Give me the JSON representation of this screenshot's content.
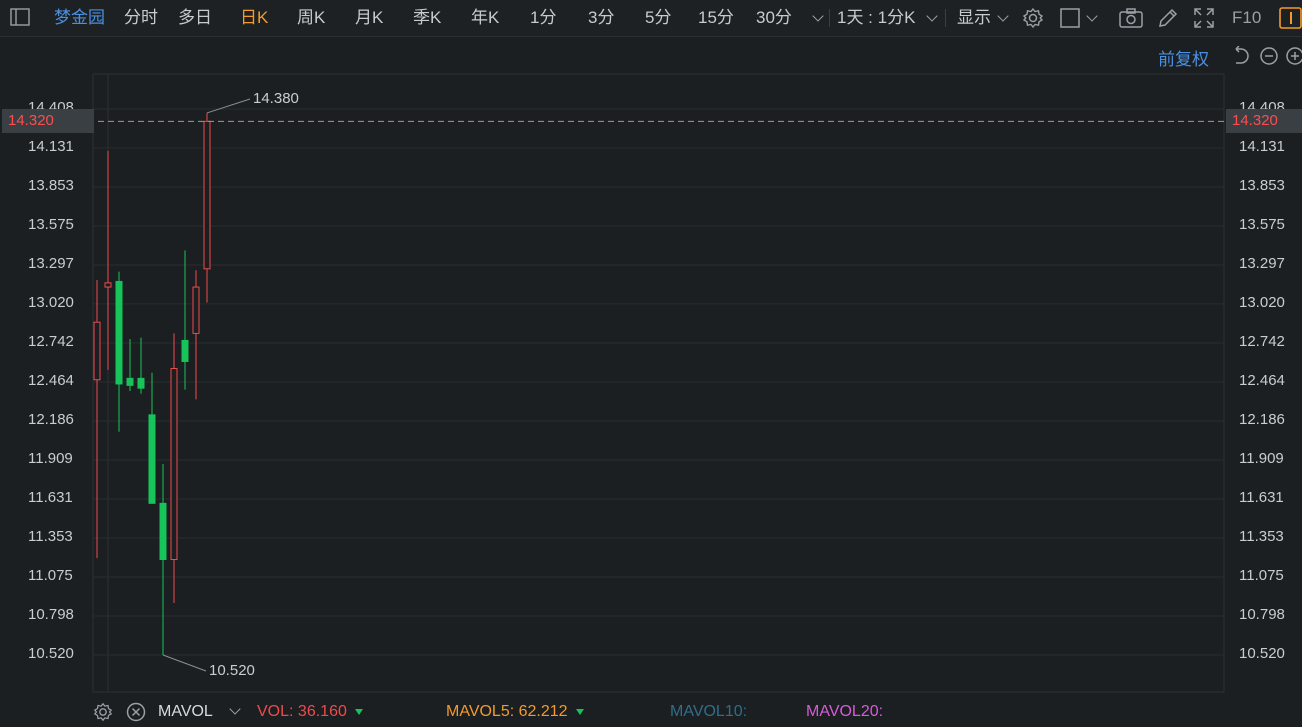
{
  "toolbar": {
    "stock_name": "梦金园",
    "tabs": [
      {
        "label": "分时",
        "x": 124
      },
      {
        "label": "多日",
        "x": 178
      },
      {
        "label": "日K",
        "x": 240,
        "active": true
      },
      {
        "label": "周K",
        "x": 297
      },
      {
        "label": "月K",
        "x": 355
      },
      {
        "label": "季K",
        "x": 413
      },
      {
        "label": "年K",
        "x": 471
      },
      {
        "label": "1分",
        "x": 530
      },
      {
        "label": "3分",
        "x": 588
      },
      {
        "label": "5分",
        "x": 645
      },
      {
        "label": "15分",
        "x": 698
      },
      {
        "label": "30分",
        "x": 756
      }
    ],
    "period_select": "1天 : 1分K",
    "display_label": "显示",
    "f10_label": "F10"
  },
  "chart_header": {
    "adjust_label": "前复权"
  },
  "current_price": "14.320",
  "annotations": {
    "high": "14.380",
    "low": "10.520"
  },
  "chart_data": {
    "type": "candlestick",
    "y_ticks": [
      "14.408",
      "14.131",
      "13.853",
      "13.575",
      "13.297",
      "13.020",
      "12.742",
      "12.464",
      "12.186",
      "11.909",
      "11.631",
      "11.353",
      "11.075",
      "10.798",
      "10.520"
    ],
    "ylim": [
      10.52,
      14.408
    ],
    "candles": [
      {
        "open": 12.48,
        "close": 12.89,
        "high": 13.19,
        "low": 11.21,
        "up": true
      },
      {
        "open": 13.14,
        "close": 13.17,
        "high": 14.11,
        "low": 12.55,
        "up": true
      },
      {
        "open": 13.18,
        "close": 12.45,
        "high": 13.25,
        "low": 12.11,
        "up": false
      },
      {
        "open": 12.49,
        "close": 12.44,
        "high": 12.77,
        "low": 12.4,
        "up": false
      },
      {
        "open": 12.49,
        "close": 12.42,
        "high": 12.78,
        "low": 12.38,
        "up": false
      },
      {
        "open": 12.23,
        "close": 11.6,
        "high": 12.53,
        "low": 11.6,
        "up": false
      },
      {
        "open": 11.6,
        "close": 11.2,
        "high": 11.88,
        "low": 10.52,
        "up": false
      },
      {
        "open": 11.2,
        "close": 12.56,
        "high": 12.81,
        "low": 10.89,
        "up": true
      },
      {
        "open": 12.76,
        "close": 12.61,
        "high": 13.4,
        "low": 12.41,
        "up": false
      },
      {
        "open": 12.81,
        "close": 13.14,
        "high": 13.26,
        "low": 12.34,
        "up": true
      },
      {
        "open": 13.27,
        "close": 14.32,
        "high": 14.38,
        "low": 13.03,
        "up": true
      }
    ]
  },
  "indicators": {
    "name": "MAVOL",
    "vol_label": "VOL:",
    "vol_value": "36.160",
    "mavol5_label": "MAVOL5:",
    "mavol5_value": "62.212",
    "mavol10_label": "MAVOL10:",
    "mavol20_label": "MAVOL20:"
  },
  "colors": {
    "up": "#f04a4a",
    "down": "#16c45a",
    "accent": "#f39a2a",
    "link": "#4a90e2"
  }
}
